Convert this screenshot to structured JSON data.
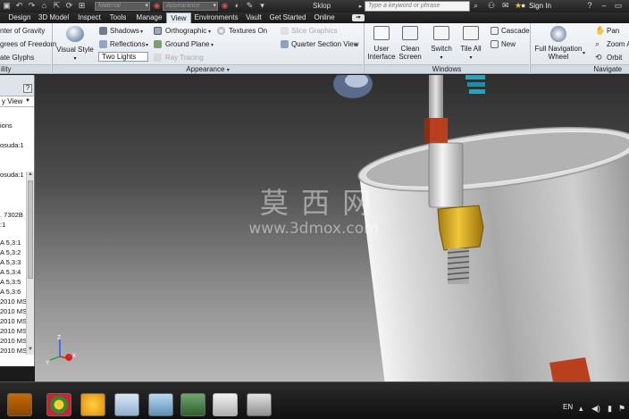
{
  "titlebar": {
    "material_placeholder": "Material",
    "appearance_placeholder": "Appearance",
    "document_title": "Sklop",
    "search_placeholder": "Type a keyword or phrase",
    "sign_in": "Sign In"
  },
  "tabs": [
    {
      "label": "Design"
    },
    {
      "label": "3D Model"
    },
    {
      "label": "Inspect"
    },
    {
      "label": "Tools"
    },
    {
      "label": "Manage"
    },
    {
      "label": "View"
    },
    {
      "label": "Environments"
    },
    {
      "label": "Vault"
    },
    {
      "label": "Get Started"
    },
    {
      "label": "Online"
    }
  ],
  "active_tab": "View",
  "ribbon": {
    "visibility": {
      "center_of_gravity": "nter of Gravity",
      "degrees_of_freedom": "grees of Freedom",
      "ate_glyphs": "ate Glyphs",
      "panel_label": "ility"
    },
    "appearance": {
      "visual_style": "Visual Style",
      "shadows": "Shadows",
      "reflections": "Reflections",
      "lights": "Two Lights",
      "orthographic": "Orthographic",
      "ground_plane": "Ground Plane",
      "ray_tracing": "Ray Tracing",
      "textures_on": "Textures On",
      "slice_graphics": "Slice Graphics",
      "quarter_section_view": "Quarter Section View",
      "panel_label": "Appearance"
    },
    "windows": {
      "user_interface_1": "User",
      "user_interface_2": "Interface",
      "clean_screen_1": "Clean",
      "clean_screen_2": "Screen",
      "switch": "Switch",
      "tile_all": "Tile All",
      "cascade": "Cascade",
      "new": "New",
      "panel_label": "Windows"
    },
    "navigate": {
      "full_nav_1": "Full Navigation",
      "full_nav_2": "Wheel",
      "pan": "Pan",
      "zoom_all": "Zoom A",
      "orbit": "Orbit",
      "panel_label": "Navigate"
    }
  },
  "browser": {
    "view_select": "y View",
    "nodes": [
      "ions",
      "osuda:1",
      "osuda:1",
      ". 7302B",
      ":1",
      "A 5,3:1",
      "A 5,3:2",
      "A 5,3:3",
      "A 5,3:4",
      "A 5,3:5",
      "A 5,3:6",
      "2010 MS",
      "2010 MS",
      "2010 MS",
      "2010 MS",
      "2010 MS",
      "2010 MS"
    ]
  },
  "viewport": {
    "watermark_cn": "莫 西 网",
    "watermark_url": "www.3dmox.com",
    "axis_labels": {
      "z": "Z",
      "x": "X",
      "y": "Y"
    }
  },
  "taskbar": {
    "language": "EN"
  },
  "colors": {
    "accent_tab": "#e6ecf3",
    "cylinder": "#c9c9c9",
    "fitting_red": "#b9401e",
    "fitting_gold": "#d7a61c",
    "axis_z": "#3355ff",
    "axis_x": "#dd2222",
    "axis_y": "#22aa33"
  }
}
